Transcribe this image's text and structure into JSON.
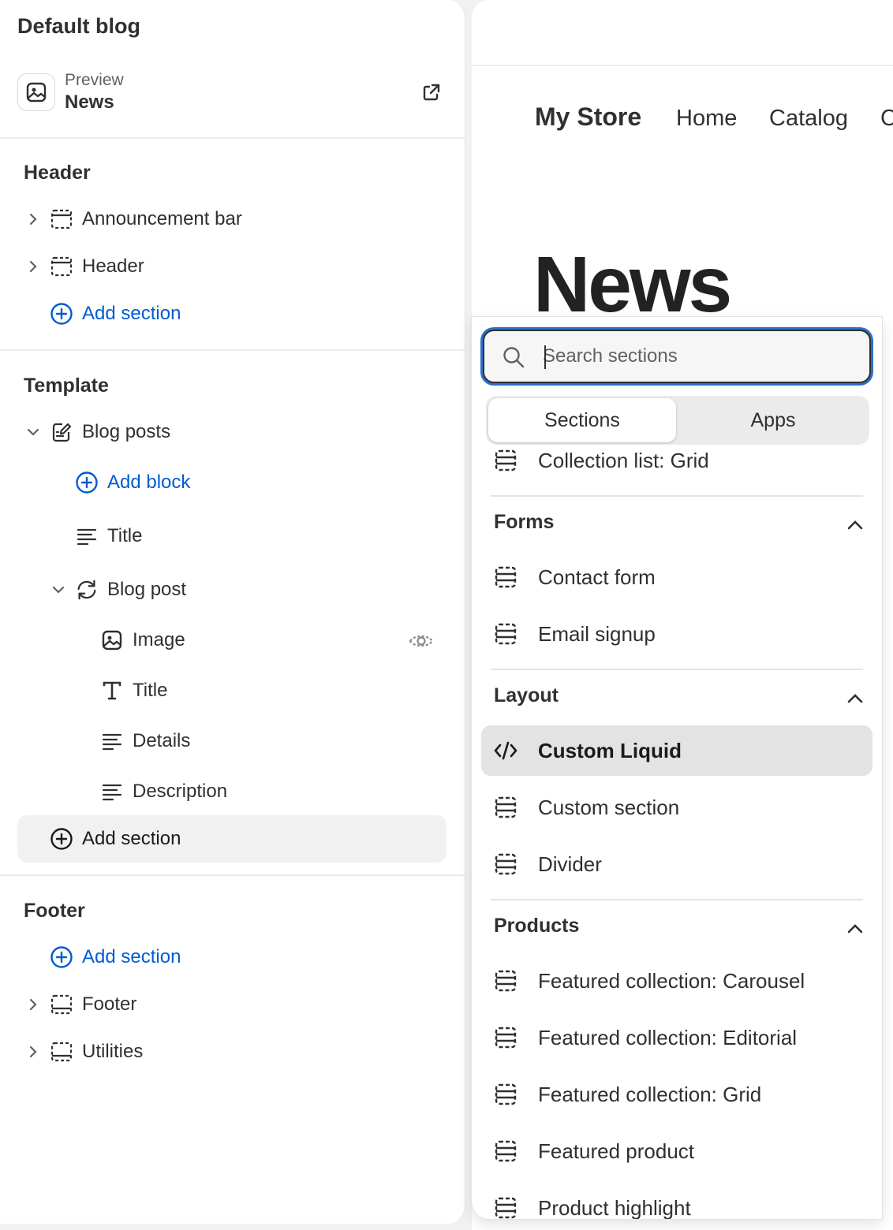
{
  "sidebar": {
    "title": "Default blog",
    "preview_label": "Preview",
    "preview_value": "News",
    "groups": {
      "header": {
        "title": "Header",
        "items": [
          "Announcement bar",
          "Header"
        ],
        "add": "Add section"
      },
      "template": {
        "title": "Template",
        "blog_posts": "Blog posts",
        "add_block": "Add block",
        "title_block": "Title",
        "blog_post": "Blog post",
        "blocks": [
          "Image",
          "Title",
          "Details",
          "Description"
        ],
        "add": "Add section"
      },
      "footer": {
        "title": "Footer",
        "add": "Add section",
        "items": [
          "Footer",
          "Utilities"
        ]
      }
    }
  },
  "preview": {
    "store": "My Store",
    "nav": [
      "Home",
      "Catalog",
      "C"
    ],
    "heading": "News"
  },
  "picker": {
    "search_placeholder": "Search sections",
    "tabs": [
      "Sections",
      "Apps"
    ],
    "partial_item": "Collection list: Grid",
    "categories": {
      "forms": {
        "title": "Forms",
        "items": [
          "Contact form",
          "Email signup"
        ]
      },
      "layout": {
        "title": "Layout",
        "items": [
          "Custom Liquid",
          "Custom section",
          "Divider"
        ]
      },
      "products": {
        "title": "Products",
        "items": [
          "Featured collection: Carousel",
          "Featured collection: Editorial",
          "Featured collection: Grid",
          "Featured product",
          "Product highlight"
        ]
      }
    },
    "selected": "Custom Liquid"
  },
  "colors": {
    "link": "#005bd3",
    "focus": "#2c6ecb",
    "selected_bg": "#e3e3e3"
  }
}
